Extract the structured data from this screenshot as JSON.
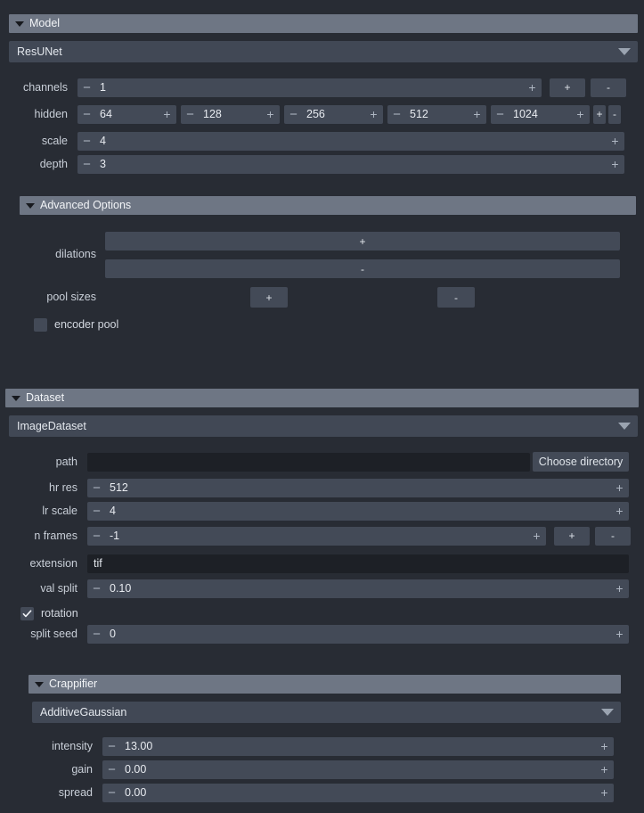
{
  "model": {
    "header": "Model",
    "model_select": "ResUNet",
    "rows": {
      "channels": {
        "label": "channels",
        "value": "1"
      },
      "hidden": {
        "label": "hidden",
        "values": [
          "64",
          "128",
          "256",
          "512",
          "1024"
        ]
      },
      "scale": {
        "label": "scale",
        "value": "4"
      },
      "depth": {
        "label": "depth",
        "value": "3"
      }
    },
    "add_label": "+",
    "remove_label": "-"
  },
  "advanced": {
    "header": "Advanced Options",
    "dilations": {
      "label": "dilations",
      "add_label": "+",
      "remove_label": "-"
    },
    "pool_sizes": {
      "label": "pool sizes",
      "add_label": "+",
      "remove_label": "-"
    },
    "encoder_pool": {
      "label": "encoder pool",
      "checked": false
    }
  },
  "dataset": {
    "header": "Dataset",
    "dataset_select": "ImageDataset",
    "path": {
      "label": "path",
      "value": "",
      "button": "Choose directory"
    },
    "hr_res": {
      "label": "hr res",
      "value": "512"
    },
    "lr_scale": {
      "label": "lr scale",
      "value": "4"
    },
    "n_frames": {
      "label": "n frames",
      "value": "-1",
      "add_label": "+",
      "remove_label": "-"
    },
    "extension": {
      "label": "extension",
      "value": "tif"
    },
    "val_split": {
      "label": "val split",
      "value": "0.10"
    },
    "rotation": {
      "label": "rotation",
      "checked": true
    },
    "split_seed": {
      "label": "split seed",
      "value": "0"
    }
  },
  "crappifier": {
    "header": "Crappifier",
    "crappifier_select": "AdditiveGaussian",
    "intensity": {
      "label": "intensity",
      "value": "13.00"
    },
    "gain": {
      "label": "gain",
      "value": "0.00"
    },
    "spread": {
      "label": "spread",
      "value": "0.00"
    }
  },
  "icons": {
    "collapse_triangle": "triangle-down-icon",
    "dropdown_caret": "caret-down-icon",
    "check": "check-icon",
    "minus": "minus-icon",
    "plus": "plus-icon"
  },
  "colors": {
    "background": "#282c34",
    "header_bar": "#6e7684",
    "control": "#434a57",
    "combo": "#414855",
    "text_input": "#1d2026",
    "text": "#d3d8e0"
  }
}
